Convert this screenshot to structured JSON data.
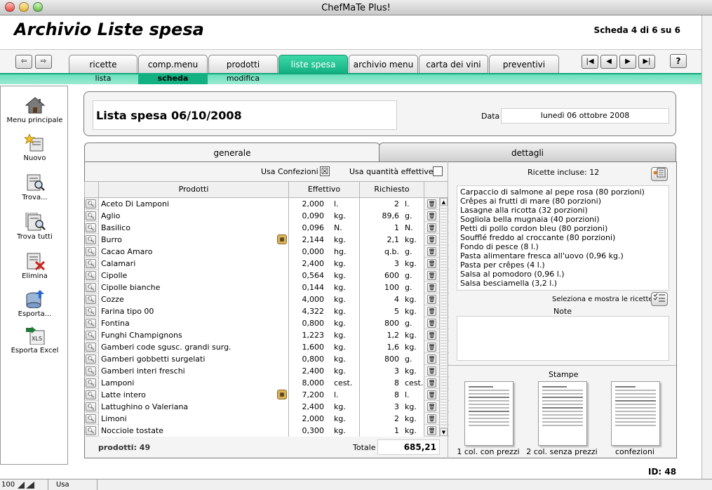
{
  "window": {
    "title": "ChefMaTe Plus!"
  },
  "header": {
    "title": "Archivio Liste spesa",
    "record_position": "Scheda 4 di 6 su 6"
  },
  "nav": {
    "back": "⇦",
    "forward": "⇨",
    "first": "|◀",
    "prev": "◀",
    "next": "▶",
    "last": "▶|",
    "help": "?"
  },
  "tabs": [
    {
      "label": "ricette"
    },
    {
      "label": "comp.menu"
    },
    {
      "label": "prodotti"
    },
    {
      "label": "liste spesa"
    },
    {
      "label": "archivio menu"
    },
    {
      "label": "carta dei vini"
    },
    {
      "label": "preventivi"
    }
  ],
  "subtabs": [
    {
      "label": "lista"
    },
    {
      "label": "scheda"
    },
    {
      "label": "modifica"
    }
  ],
  "sidebar": [
    {
      "label": "Menu principale",
      "icon": "home-icon"
    },
    {
      "label": "Nuovo",
      "icon": "new-record-icon"
    },
    {
      "label": "Trova...",
      "icon": "find-icon"
    },
    {
      "label": "Trova tutti",
      "icon": "find-all-icon"
    },
    {
      "label": "Elimina",
      "icon": "delete-icon"
    },
    {
      "label": "Esporta...",
      "icon": "export-icon"
    },
    {
      "label": "Esporta Excel",
      "icon": "excel-icon"
    }
  ],
  "list": {
    "name": "Lista spesa 06/10/2008",
    "date_label": "Data",
    "date_value": "lunedì 06 ottobre 2008"
  },
  "panel_tabs": {
    "general": "generale",
    "details": "dettagli"
  },
  "options": {
    "use_packages_label": "Usa Confezioni",
    "use_packages_checked": true,
    "use_actual_qty_label": "Usa quantità effettive",
    "use_actual_qty_checked": false
  },
  "table": {
    "headers": {
      "product": "Prodotti",
      "actual": "Effettivo",
      "requested": "Richiesto"
    },
    "rows": [
      {
        "name": "Aceto Di Lamponi",
        "eff": "2,000",
        "eff_unit": "l.",
        "req": "2",
        "req_unit": "l.",
        "pkg": false
      },
      {
        "name": "Aglio",
        "eff": "0,090",
        "eff_unit": "kg.",
        "req": "89,6",
        "req_unit": "g.",
        "pkg": false
      },
      {
        "name": "Basilico",
        "eff": "0,096",
        "eff_unit": "N.",
        "req": "1",
        "req_unit": "N.",
        "pkg": false
      },
      {
        "name": "Burro",
        "eff": "2,144",
        "eff_unit": "kg.",
        "req": "2,1",
        "req_unit": "kg.",
        "pkg": true
      },
      {
        "name": "Cacao Amaro",
        "eff": "0,000",
        "eff_unit": "hg.",
        "req": "q.b.",
        "req_unit": "g.",
        "pkg": false
      },
      {
        "name": "Calamari",
        "eff": "2,400",
        "eff_unit": "kg.",
        "req": "3",
        "req_unit": "kg.",
        "pkg": false
      },
      {
        "name": "Cipolle",
        "eff": "0,564",
        "eff_unit": "kg.",
        "req": "600",
        "req_unit": "g.",
        "pkg": false
      },
      {
        "name": "Cipolle bianche",
        "eff": "0,144",
        "eff_unit": "kg.",
        "req": "100",
        "req_unit": "g.",
        "pkg": false
      },
      {
        "name": "Cozze",
        "eff": "4,000",
        "eff_unit": "kg.",
        "req": "4",
        "req_unit": "kg.",
        "pkg": false
      },
      {
        "name": "Farina tipo 00",
        "eff": "4,322",
        "eff_unit": "kg.",
        "req": "5",
        "req_unit": "kg.",
        "pkg": false
      },
      {
        "name": "Fontina",
        "eff": "0,800",
        "eff_unit": "kg.",
        "req": "800",
        "req_unit": "g.",
        "pkg": false
      },
      {
        "name": "Funghi Champignons",
        "eff": "1,223",
        "eff_unit": "kg.",
        "req": "1,2",
        "req_unit": "kg.",
        "pkg": false
      },
      {
        "name": "Gamberi code sgusc. grandi surg.",
        "eff": "1,600",
        "eff_unit": "kg.",
        "req": "1,6",
        "req_unit": "kg.",
        "pkg": false
      },
      {
        "name": "Gamberi gobbetti surgelati",
        "eff": "0,800",
        "eff_unit": "kg.",
        "req": "800",
        "req_unit": "g.",
        "pkg": false
      },
      {
        "name": "Gamberi interi freschi",
        "eff": "2,400",
        "eff_unit": "kg.",
        "req": "3",
        "req_unit": "kg.",
        "pkg": false
      },
      {
        "name": "Lamponi",
        "eff": "8,000",
        "eff_unit": "cest.",
        "req": "8",
        "req_unit": "cest.",
        "pkg": false
      },
      {
        "name": "Latte intero",
        "eff": "7,200",
        "eff_unit": "l.",
        "req": "8",
        "req_unit": "l.",
        "pkg": true
      },
      {
        "name": "Lattughino o Valeriana",
        "eff": "2,400",
        "eff_unit": "kg.",
        "req": "3",
        "req_unit": "kg.",
        "pkg": false
      },
      {
        "name": "Limoni",
        "eff": "2,000",
        "eff_unit": "kg.",
        "req": "2",
        "req_unit": "kg.",
        "pkg": false
      },
      {
        "name": "Nocciole tostate",
        "eff": "0,300",
        "eff_unit": "kg.",
        "req": "1",
        "req_unit": "kg.",
        "pkg": false
      }
    ]
  },
  "footer": {
    "products_count": "prodotti: 49",
    "total_label": "Totale",
    "total_value": "685,21",
    "id": "ID: 48"
  },
  "details": {
    "recipes_label": "Ricette incluse: 12",
    "recipes": [
      "Carpaccio di salmone al pepe rosa (80 porzioni)",
      "Crêpes ai frutti di mare (80 porzioni)",
      "Lasagne alla ricotta (32 porzioni)",
      "Sogliola bella mugnaia (40 porzioni)",
      "Petti di pollo cordon bleu (80 porzioni)",
      "Soufflé freddo al croccante (80 porzioni)",
      "Fondo di pesce (8 l.)",
      "Pasta alimentare fresca all'uovo (0,96 kg.)",
      "Pasta per crêpes (4 l.)",
      "Salsa al pomodoro (0,96 l.)",
      "Salsa besciamella (3,2 l.)"
    ],
    "select_recipes_label": "Seleziona e mostra le ricette",
    "notes_label": "Note",
    "prints_label": "Stampe",
    "prints": [
      {
        "label": "1 col. con prezzi"
      },
      {
        "label": "2 col. senza prezzi"
      },
      {
        "label": "confezioni"
      }
    ]
  },
  "statusbar": {
    "zoom": "100",
    "mode": "Usa"
  }
}
